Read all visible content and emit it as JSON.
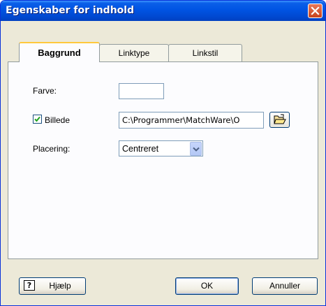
{
  "window": {
    "title": "Egenskaber for indhold"
  },
  "tabs": [
    {
      "label": "Baggrund",
      "active": true
    },
    {
      "label": "Linktype",
      "active": false
    },
    {
      "label": "Linkstil",
      "active": false
    }
  ],
  "form": {
    "color_label": "Farve:",
    "color_value": "",
    "image_checkbox_label": "Billede",
    "image_checked": true,
    "image_path": "C:\\Programmer\\MatchWare\\O",
    "placement_label": "Placering:",
    "placement_value": "Centreret"
  },
  "buttons": {
    "help": "Hjælp",
    "ok": "OK",
    "cancel": "Annuller"
  },
  "icons": {
    "close": "close-icon",
    "check": "checkmark-icon",
    "browse": "folder-open-icon",
    "dropdown": "chevron-down-icon",
    "help": "question-mark-icon"
  },
  "colors": {
    "titlebar": "#0054e3",
    "dialog_bg": "#ece9d8",
    "active_tab_accent": "#ffc83c",
    "close_button": "#c7431c"
  }
}
